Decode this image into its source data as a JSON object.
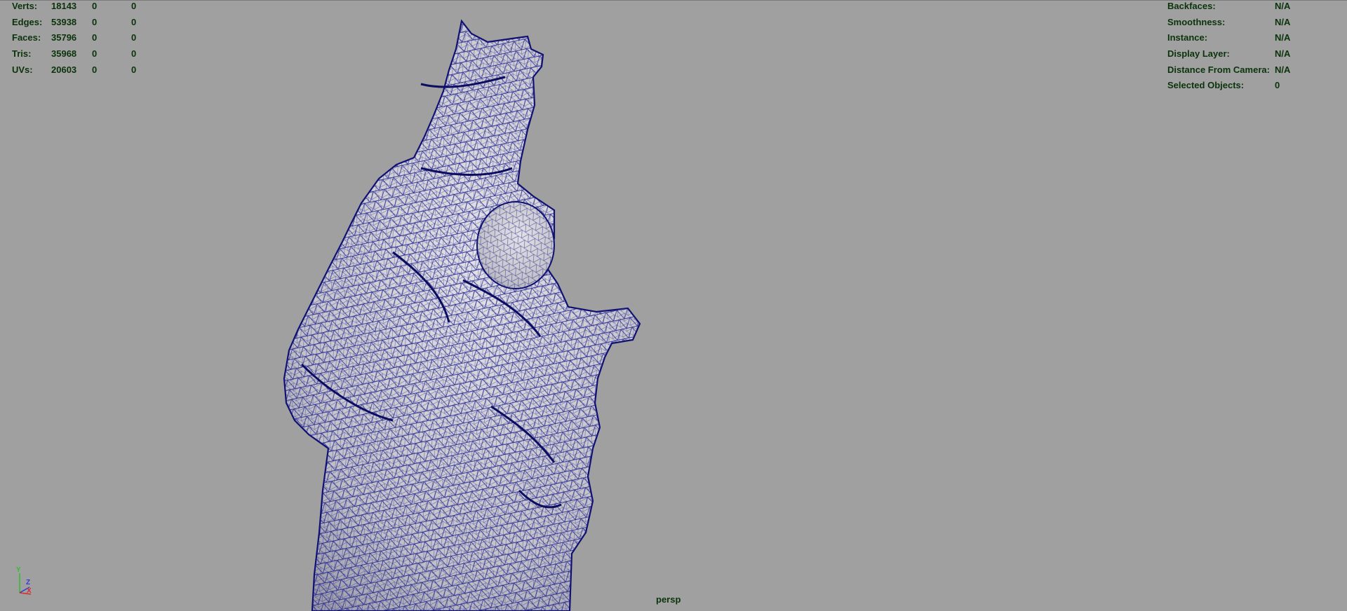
{
  "stats": {
    "rows": [
      {
        "label": "Verts:",
        "v1": "18143",
        "v2": "0",
        "v3": "0"
      },
      {
        "label": "Edges:",
        "v1": "53938",
        "v2": "0",
        "v3": "0"
      },
      {
        "label": "Faces:",
        "v1": "35796",
        "v2": "0",
        "v3": "0"
      },
      {
        "label": "Tris:",
        "v1": "35968",
        "v2": "0",
        "v3": "0"
      },
      {
        "label": "UVs:",
        "v1": "20603",
        "v2": "0",
        "v3": "0"
      }
    ]
  },
  "info": {
    "rows": [
      {
        "label": "Backfaces:",
        "value": "N/A"
      },
      {
        "label": "Smoothness:",
        "value": "N/A"
      },
      {
        "label": "Instance:",
        "value": "N/A"
      },
      {
        "label": "Display Layer:",
        "value": "N/A"
      },
      {
        "label": "Distance From Camera:",
        "value": "N/A"
      },
      {
        "label": "Selected Objects:",
        "value": "0"
      }
    ]
  },
  "camera": {
    "name": "persp"
  },
  "axis": {
    "y": "Y",
    "z": "Z",
    "x": "X"
  },
  "colors": {
    "viewport_bg": "#a0a0a0",
    "hud_text": "#0b330b",
    "wireframe": "#1a1a8c",
    "mesh_fill": "#c8c8cc"
  }
}
